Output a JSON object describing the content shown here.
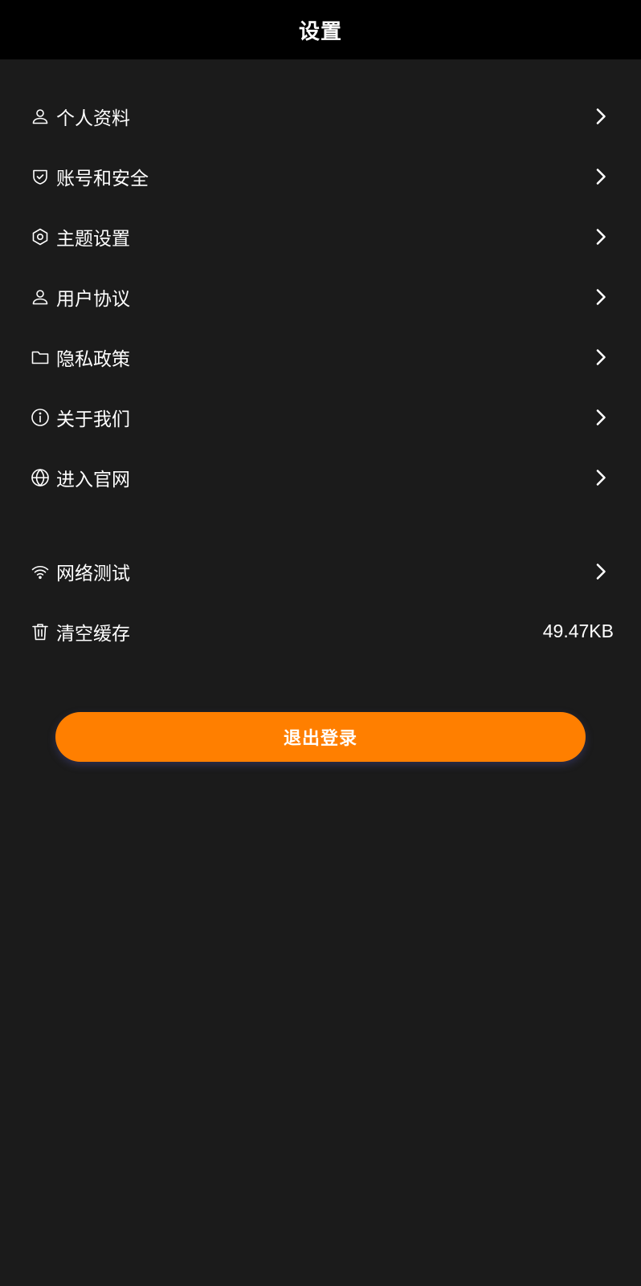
{
  "header": {
    "title": "设置"
  },
  "menu_group_1": [
    {
      "label": "个人资料",
      "icon": "user-icon"
    },
    {
      "label": "账号和安全",
      "icon": "shield-check-icon"
    },
    {
      "label": "主题设置",
      "icon": "hexagon-settings-icon"
    },
    {
      "label": "用户协议",
      "icon": "user-icon"
    },
    {
      "label": "隐私政策",
      "icon": "folder-icon"
    },
    {
      "label": "关于我们",
      "icon": "info-icon"
    },
    {
      "label": "进入官网",
      "icon": "globe-icon"
    }
  ],
  "menu_group_2": [
    {
      "label": "网络测试",
      "icon": "wifi-icon"
    },
    {
      "label": "清空缓存",
      "icon": "trash-icon",
      "value": "49.47KB"
    }
  ],
  "logout": {
    "label": "退出登录"
  },
  "colors": {
    "background": "#1b1b1b",
    "header_background": "#000000",
    "accent": "#ff7f00",
    "text": "#ffffff"
  }
}
